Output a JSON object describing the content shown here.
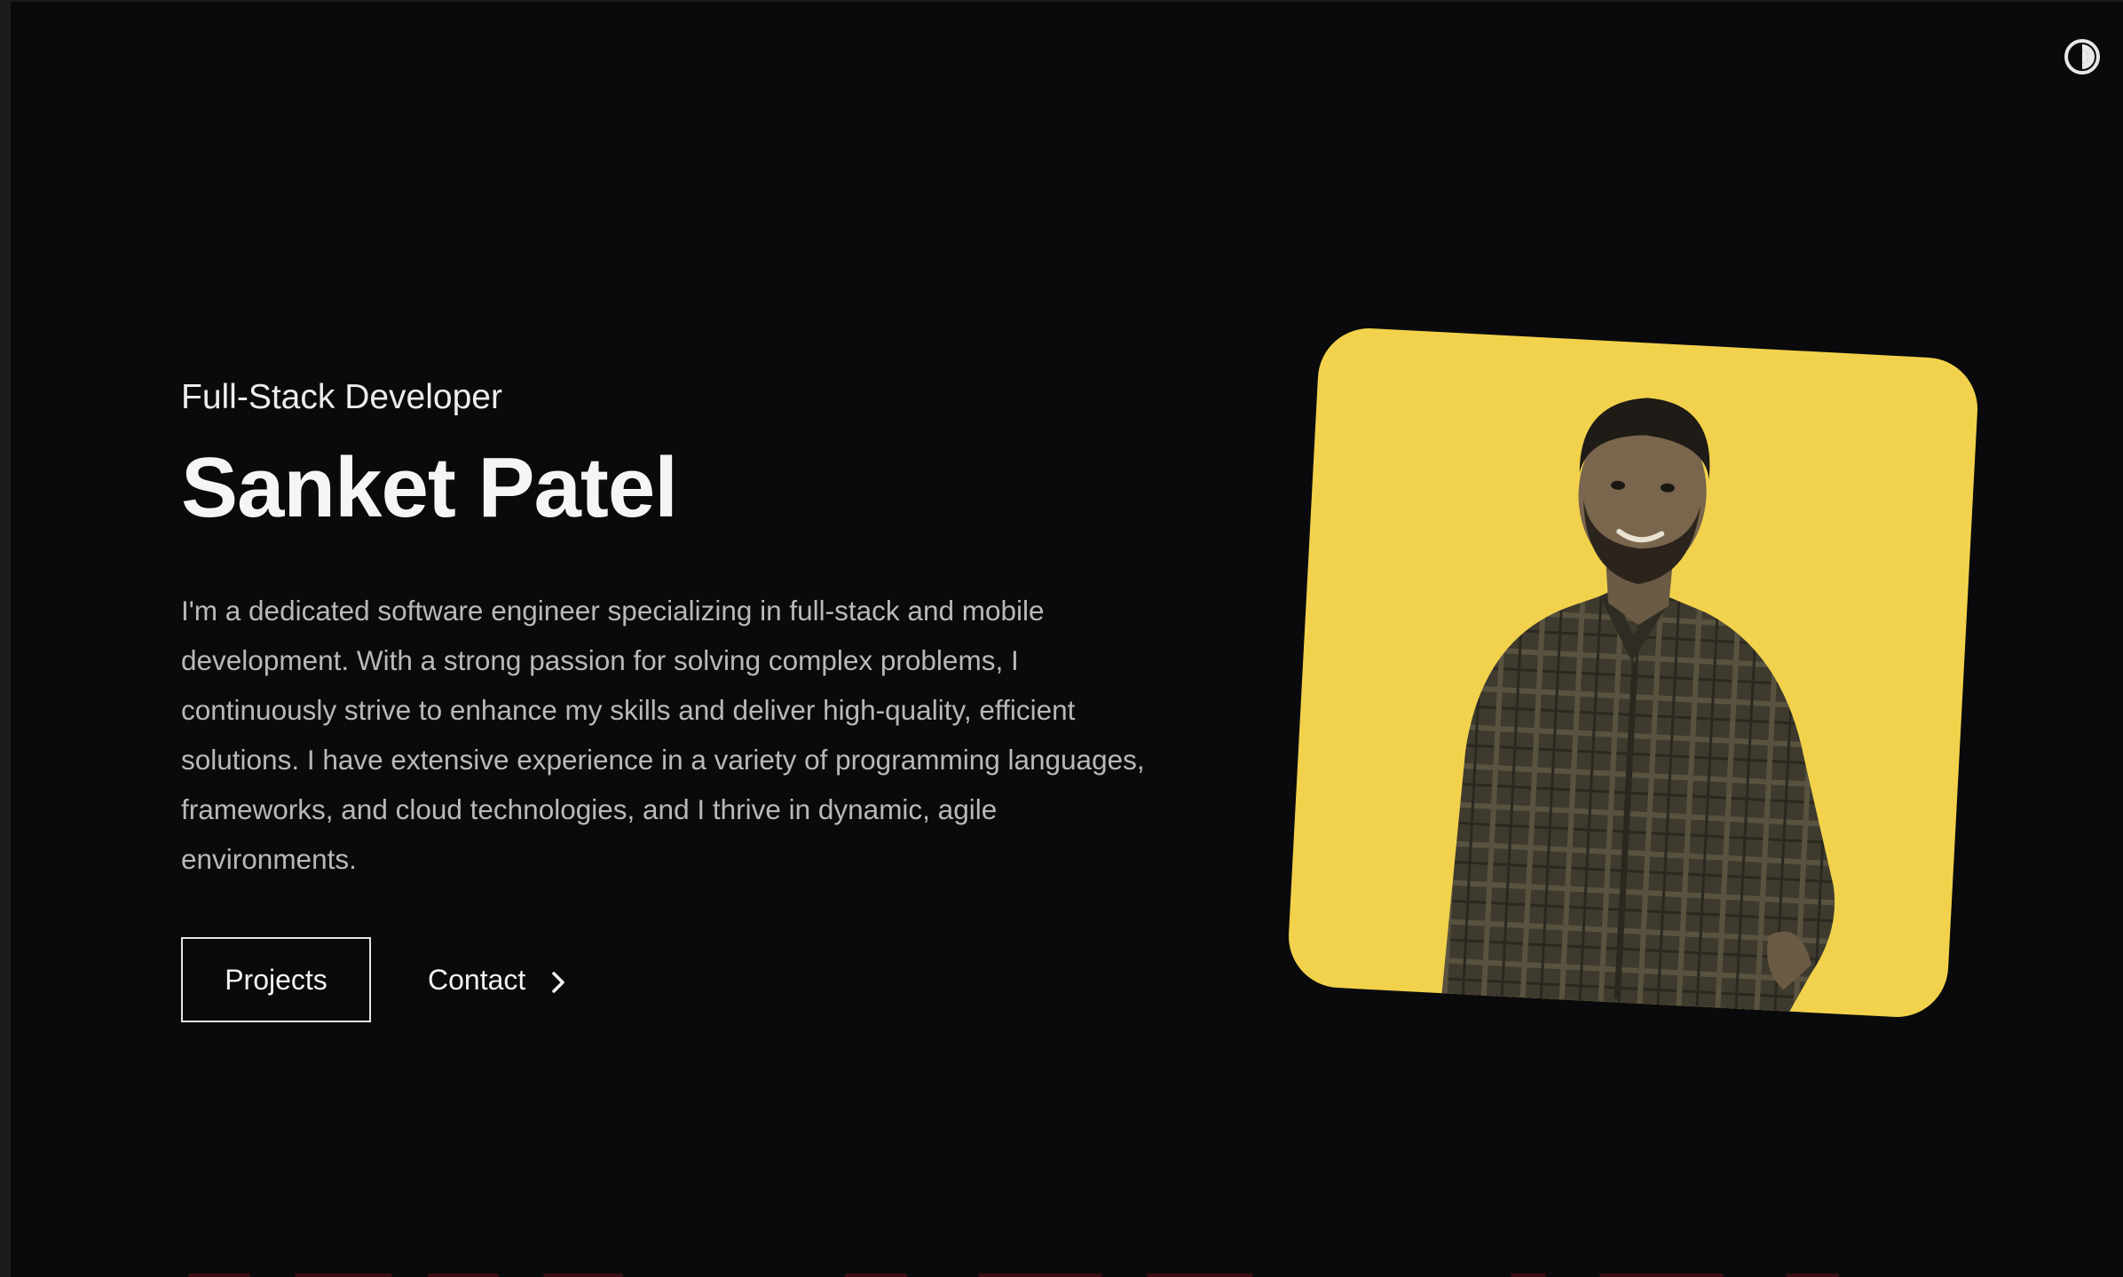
{
  "hero": {
    "subtitle": "Full-Stack Developer",
    "name": "Sanket Patel",
    "bio": "I'm a dedicated software engineer specializing in full-stack and mobile development. With a strong passion for solving complex problems, I continuously strive to enhance my skills and deliver high-quality, efficient solutions. I have extensive experience in a variety of programming languages, frameworks, and cloud technologies, and I thrive in dynamic, agile environments."
  },
  "actions": {
    "projects_label": "Projects",
    "contact_label": "Contact"
  },
  "icons": {
    "theme_toggle": "theme-toggle-icon",
    "contact_arrow": "chevron-right-icon"
  },
  "colors": {
    "background": "#0a0a0c",
    "photo_background": "#f2d24c",
    "text_primary": "#f5f5f5",
    "text_secondary": "#b9b9b9"
  }
}
